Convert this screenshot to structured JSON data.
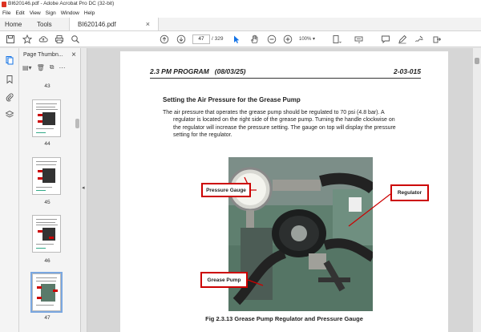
{
  "window": {
    "title": "BI620146.pdf - Adobe Acrobat Pro DC (32-bit)"
  },
  "menu": [
    "File",
    "Edit",
    "View",
    "Sign",
    "Window",
    "Help"
  ],
  "tabs": {
    "home": "Home",
    "tools": "Tools",
    "document": "BI620146.pdf"
  },
  "toolbar": {
    "current_page": "47",
    "page_total": "/ 329",
    "zoom": "100%"
  },
  "thumbnails": {
    "title": "Page Thumbn...",
    "pages": [
      "43",
      "44",
      "45",
      "46",
      "47"
    ],
    "selected": "47"
  },
  "document": {
    "header_left": "2.3 PM PROGRAM   (08/03/25)",
    "header_right": "2-03-015",
    "section_title": "Setting the Air Pressure for the Grease Pump",
    "paragraph_first": "The air pressure that operates the grease pump should be regulated to 70 psi (4.8 bar). A",
    "paragraph_lines": [
      "regulator is located on the right side of the grease pump. Turning the handle clockwise on",
      "the regulator will increase the pressure setting. The gauge on top will display the pressure",
      "setting for the regulator."
    ],
    "callouts": {
      "pressure_gauge": "Pressure Gauge",
      "regulator": "Regulator",
      "grease_pump": "Grease Pump"
    },
    "caption": "Fig 2.3.13 Grease Pump Regulator and Pressure Gauge"
  },
  "colors": {
    "accent": "#1473e6",
    "callout_border": "#cc0000"
  }
}
